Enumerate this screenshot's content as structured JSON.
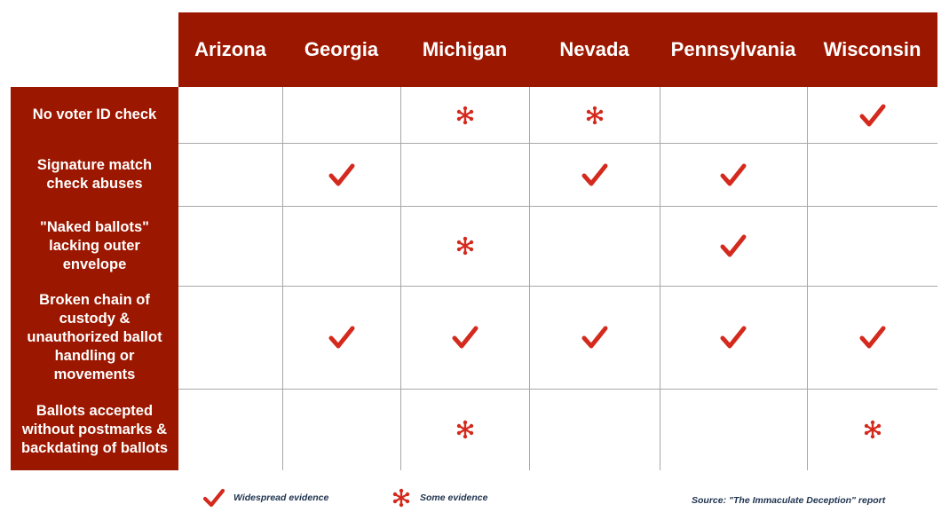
{
  "table": {
    "columns": [
      "Arizona",
      "Georgia",
      "Michigan",
      "Nevada",
      "Pennsylvania",
      "Wisconsin"
    ],
    "rows": [
      {
        "label": "No voter ID check",
        "cells": [
          "",
          "",
          "some",
          "some",
          "",
          "widespread"
        ]
      },
      {
        "label": "Signature match check abuses",
        "cells": [
          "",
          "widespread",
          "",
          "widespread",
          "widespread",
          ""
        ]
      },
      {
        "label": "\"Naked ballots\" lacking outer envelope",
        "cells": [
          "",
          "",
          "some",
          "",
          "widespread",
          ""
        ]
      },
      {
        "label": "Broken chain of custody & unauthorized ballot handling or movements",
        "cells": [
          "",
          "widespread",
          "widespread",
          "widespread",
          "widespread",
          "widespread"
        ]
      },
      {
        "label": "Ballots accepted without postmarks & backdating of ballots",
        "cells": [
          "",
          "",
          "some",
          "",
          "",
          "some"
        ]
      }
    ]
  },
  "legend": {
    "widespread": {
      "icon": "checkmark-icon",
      "label": "Widespread evidence"
    },
    "some": {
      "icon": "asterisk-icon",
      "label": "Some evidence"
    }
  },
  "source": "Source: \"The Immaculate Deception\" report",
  "colors": {
    "header_bg": "#9c1700",
    "mark": "#d42a1e",
    "legend_text": "#1f3350",
    "grid": "#a8a8a8"
  }
}
